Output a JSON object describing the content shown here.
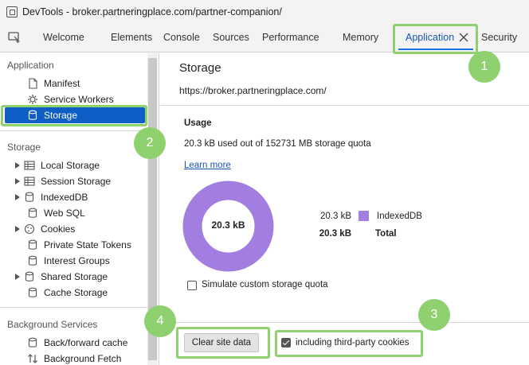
{
  "window": {
    "title": "DevTools - broker.partneringplace.com/partner-companion/"
  },
  "tabs": [
    {
      "label": "Welcome"
    },
    {
      "label": "Elements"
    },
    {
      "label": "Console"
    },
    {
      "label": "Sources"
    },
    {
      "label": "Performance"
    },
    {
      "label": "Memory"
    },
    {
      "label": "Application",
      "active": true
    },
    {
      "label": "Security"
    }
  ],
  "sidebar": {
    "application_header": "Application",
    "application_items": [
      {
        "label": "Manifest",
        "icon": "file-icon"
      },
      {
        "label": "Service Workers",
        "icon": "gear-icon"
      },
      {
        "label": "Storage",
        "icon": "database-icon",
        "selected": true
      }
    ],
    "storage_header": "Storage",
    "storage_items": [
      {
        "label": "Local Storage",
        "icon": "table-icon",
        "expandable": true
      },
      {
        "label": "Session Storage",
        "icon": "table-icon",
        "expandable": true
      },
      {
        "label": "IndexedDB",
        "icon": "database-icon",
        "expandable": true
      },
      {
        "label": "Web SQL",
        "icon": "database-icon",
        "expandable": false
      },
      {
        "label": "Cookies",
        "icon": "cookie-icon",
        "expandable": true
      },
      {
        "label": "Private State Tokens",
        "icon": "database-icon",
        "expandable": false
      },
      {
        "label": "Interest Groups",
        "icon": "database-icon",
        "expandable": false
      },
      {
        "label": "Shared Storage",
        "icon": "database-icon",
        "expandable": true
      },
      {
        "label": "Cache Storage",
        "icon": "database-icon",
        "expandable": false
      }
    ],
    "background_header": "Background Services",
    "background_items": [
      {
        "label": "Back/forward cache",
        "icon": "database-icon"
      },
      {
        "label": "Background Fetch",
        "icon": "updown-arrows-icon"
      }
    ]
  },
  "main": {
    "title": "Storage",
    "origin": "https://broker.partneringplace.com/",
    "usage_heading": "Usage",
    "usage_text": "20.3 kB used out of 152731 MB storage quota",
    "learn_more": "Learn more",
    "donut_center": "20.3 kB",
    "legend": [
      {
        "value": "20.3 kB",
        "name": "IndexedDB",
        "color": "#a17ee0",
        "bold": false
      },
      {
        "value": "20.3 kB",
        "name": "Total",
        "bold": true
      }
    ],
    "simulate_quota_label": "Simulate custom storage quota",
    "simulate_quota_checked": false,
    "clear_button": "Clear site data",
    "third_party_label": "including third-party cookies",
    "third_party_checked": true
  },
  "annotations": {
    "color": "#8fd16f",
    "badges": [
      "1",
      "2",
      "3",
      "4"
    ]
  }
}
